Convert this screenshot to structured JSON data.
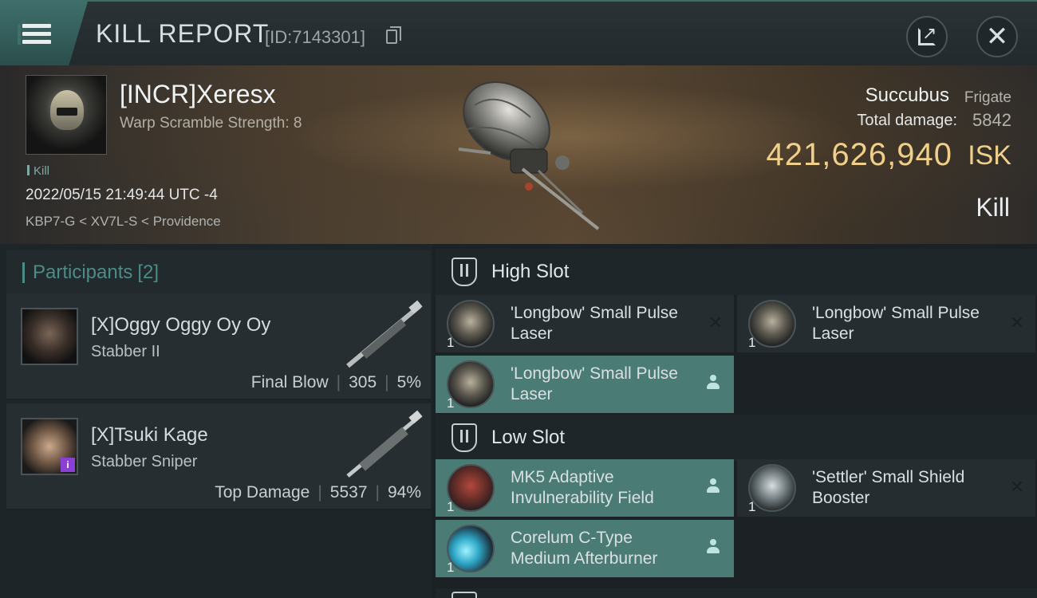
{
  "header": {
    "title": "KILL REPORT",
    "report_id": "[ID:7143301]",
    "icons": {
      "menu": "hamburger-menu-icon",
      "copy": "copy-icon",
      "share": "share-external-icon",
      "close": "close-icon"
    }
  },
  "victim": {
    "pilot": "[INCR]Xeresx",
    "warp_scramble": "Warp Scramble Strength: 8",
    "tag": "Kill",
    "datetime": "2022/05/15 21:49:44 UTC -4",
    "location": "KBP7-G < XV7L-S < Providence",
    "ship_name": "Succubus",
    "ship_class": "Frigate",
    "damage_label": "Total damage:",
    "damage_value": "5842",
    "isk_value": "421,626,940",
    "isk_unit": "ISK",
    "outcome": "Kill"
  },
  "participants": {
    "label": "Participants",
    "count": "[2]",
    "rows": [
      {
        "name": "[X]Oggy Oggy Oy Oy",
        "ship": "Stabber II",
        "role": "Final Blow",
        "damage": "305",
        "percent": "5%",
        "badge": ""
      },
      {
        "name": "[X]Tsuki Kage",
        "ship": "Stabber Sniper",
        "role": "Top Damage",
        "damage": "5537",
        "percent": "94%",
        "badge": "i"
      }
    ]
  },
  "fitting": {
    "high_slot_label": "High Slot",
    "low_slot_label": "Low Slot",
    "high": [
      {
        "qty": "1",
        "name": "'Longbow' Small Pulse Laser",
        "status": "destroyed"
      },
      {
        "qty": "1",
        "name": "'Longbow' Small Pulse Laser",
        "status": "destroyed"
      },
      {
        "qty": "1",
        "name": "'Longbow' Small Pulse Laser",
        "status": "dropped"
      }
    ],
    "low": [
      {
        "qty": "1",
        "name": "MK5 Adaptive Invulnerability Field",
        "status": "dropped"
      },
      {
        "qty": "1",
        "name": "'Settler' Small Shield Booster",
        "status": "destroyed"
      },
      {
        "qty": "1",
        "name": "Corelum C-Type Medium Afterburner",
        "status": "dropped"
      }
    ]
  },
  "colors": {
    "accent_teal": "#4c8c86",
    "isk_gold": "#f0cf8a",
    "dropped_bg": "#4a7b75"
  }
}
